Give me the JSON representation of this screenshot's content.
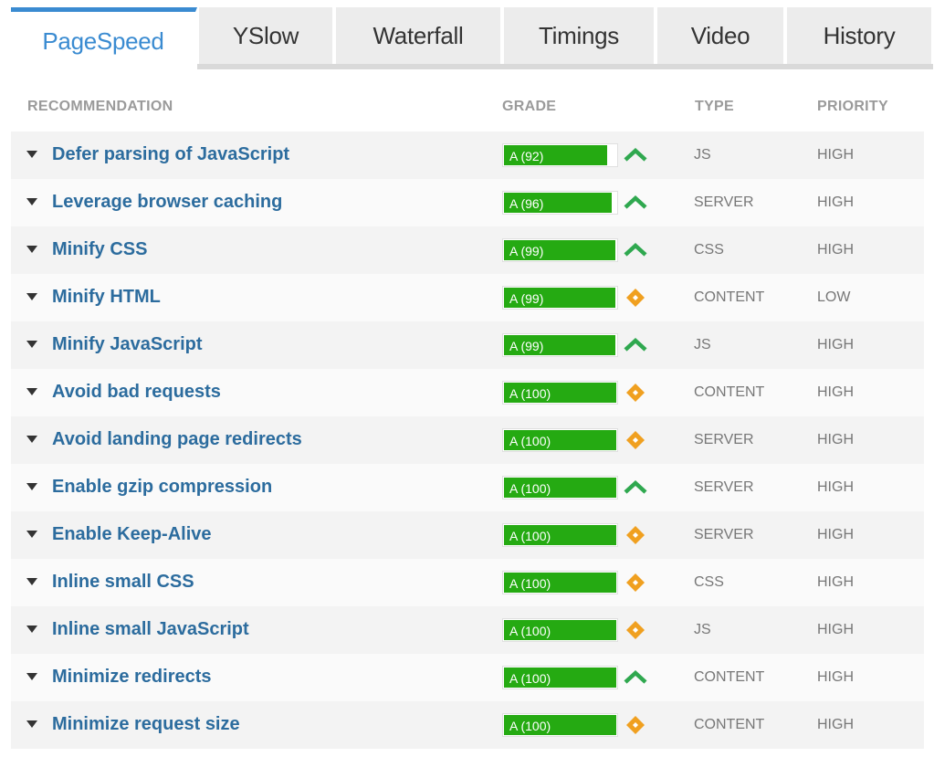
{
  "tabs": [
    {
      "label": "PageSpeed",
      "active": true
    },
    {
      "label": "YSlow",
      "active": false
    },
    {
      "label": "Waterfall",
      "active": false
    },
    {
      "label": "Timings",
      "active": false
    },
    {
      "label": "Video",
      "active": false
    },
    {
      "label": "History",
      "active": false
    }
  ],
  "table": {
    "headers": {
      "recommendation": "RECOMMENDATION",
      "grade": "GRADE",
      "type": "TYPE",
      "priority": "PRIORITY"
    },
    "rows": [
      {
        "recommendation": "Defer parsing of JavaScript",
        "grade": "A (92)",
        "score": 92,
        "trend": "up-icon",
        "type": "JS",
        "priority": "HIGH"
      },
      {
        "recommendation": "Leverage browser caching",
        "grade": "A (96)",
        "score": 96,
        "trend": "up-icon",
        "type": "SERVER",
        "priority": "HIGH"
      },
      {
        "recommendation": "Minify CSS",
        "grade": "A (99)",
        "score": 99,
        "trend": "up-icon",
        "type": "CSS",
        "priority": "HIGH"
      },
      {
        "recommendation": "Minify HTML",
        "grade": "A (99)",
        "score": 99,
        "trend": "diamond-icon",
        "type": "CONTENT",
        "priority": "LOW"
      },
      {
        "recommendation": "Minify JavaScript",
        "grade": "A (99)",
        "score": 99,
        "trend": "up-icon",
        "type": "JS",
        "priority": "HIGH"
      },
      {
        "recommendation": "Avoid bad requests",
        "grade": "A (100)",
        "score": 100,
        "trend": "diamond-icon",
        "type": "CONTENT",
        "priority": "HIGH"
      },
      {
        "recommendation": "Avoid landing page redirects",
        "grade": "A (100)",
        "score": 100,
        "trend": "diamond-icon",
        "type": "SERVER",
        "priority": "HIGH"
      },
      {
        "recommendation": "Enable gzip compression",
        "grade": "A (100)",
        "score": 100,
        "trend": "up-icon",
        "type": "SERVER",
        "priority": "HIGH"
      },
      {
        "recommendation": "Enable Keep-Alive",
        "grade": "A (100)",
        "score": 100,
        "trend": "diamond-icon",
        "type": "SERVER",
        "priority": "HIGH"
      },
      {
        "recommendation": "Inline small CSS",
        "grade": "A (100)",
        "score": 100,
        "trend": "diamond-icon",
        "type": "CSS",
        "priority": "HIGH"
      },
      {
        "recommendation": "Inline small JavaScript",
        "grade": "A (100)",
        "score": 100,
        "trend": "diamond-icon",
        "type": "JS",
        "priority": "HIGH"
      },
      {
        "recommendation": "Minimize redirects",
        "grade": "A (100)",
        "score": 100,
        "trend": "up-icon",
        "type": "CONTENT",
        "priority": "HIGH"
      },
      {
        "recommendation": "Minimize request size",
        "grade": "A (100)",
        "score": 100,
        "trend": "diamond-icon",
        "type": "CONTENT",
        "priority": "HIGH"
      }
    ]
  },
  "colors": {
    "accent": "#3a8bd1",
    "link": "#2c6c9e",
    "grade_fill": "#25aa12",
    "trend_up": "#2fa84f",
    "trend_neutral": "#f0a020"
  }
}
